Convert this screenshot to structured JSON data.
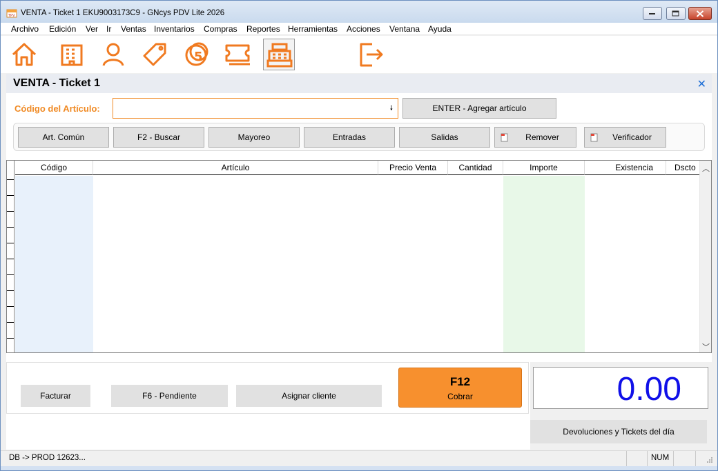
{
  "window": {
    "title": "VENTA - Ticket 1 EKU9003173C9 - GNcys PDV Lite 2026",
    "controls": [
      "minimize-icon",
      "maximize-icon",
      "close-icon"
    ]
  },
  "menu": [
    "Archivo",
    "Edición",
    "Ver",
    "Ir",
    "Ventas",
    "Inventarios",
    "Compras",
    "Reportes",
    "Herramientas",
    "Acciones",
    "Ventana",
    "Ayuda"
  ],
  "toolbar": {
    "icons": [
      "home-icon",
      "building-icon",
      "user-icon",
      "tag-icon",
      "coin-icon",
      "ticket-icon",
      "cash-register-icon",
      "exit-icon"
    ],
    "active": "cash-register-icon"
  },
  "panel": {
    "title": "VENTA - Ticket 1"
  },
  "article": {
    "label": "Código del Artículo:",
    "value": "",
    "add_button": "ENTER - Agregar artículo"
  },
  "actions": {
    "common": "Art. Común",
    "search": "F2 - Buscar",
    "wholesale": "Mayoreo",
    "entries": "Entradas",
    "exits": "Salidas",
    "remove": "Remover",
    "checker": "Verificador"
  },
  "grid": {
    "columns": [
      "Código",
      "Artículo",
      "Precio Venta",
      "Cantidad",
      "Importe",
      "Existencia",
      "Dscto"
    ],
    "rows": []
  },
  "bottom": {
    "invoice": "Facturar",
    "pending": "F6 - Pendiente",
    "assign_client": "Asignar cliente",
    "charge_key": "F12",
    "charge_label": "Cobrar",
    "total": "0.00",
    "returns": "Devoluciones y Tickets del día"
  },
  "status": {
    "db": "DB -> PROD 12623...",
    "num": "NUM"
  },
  "colors": {
    "accent": "#f08a24",
    "total": "#1010e8",
    "code_column": "#e8f1fb",
    "amount_column": "#e8f8e8"
  }
}
